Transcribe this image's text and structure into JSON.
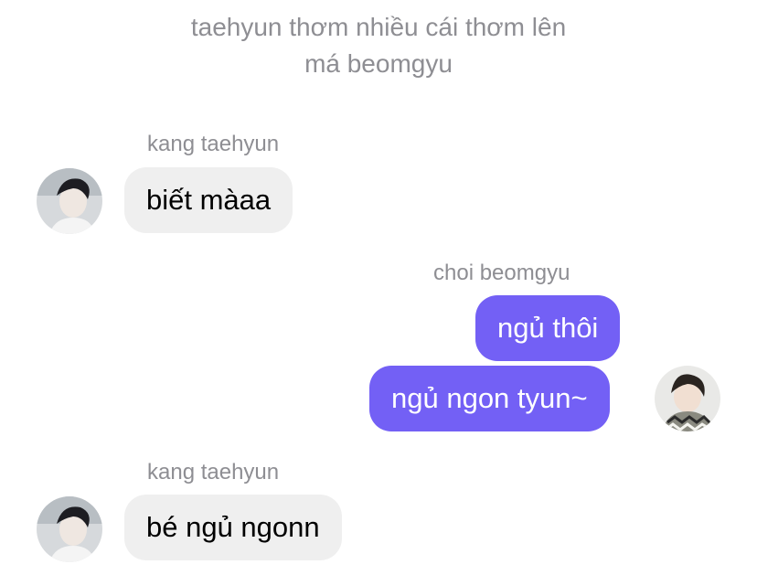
{
  "system_note": {
    "line1": "taehyun thơm nhiều cái thơm lên",
    "line2": "má beomgyu"
  },
  "messages": [
    {
      "sender": "kang taehyun",
      "text": "biết màaa",
      "direction": "incoming"
    },
    {
      "sender": "choi beomgyu",
      "texts": [
        "ngủ thôi",
        "ngủ ngon tyun~"
      ],
      "direction": "outgoing"
    },
    {
      "sender": "kang taehyun",
      "text": "bé ngủ ngonn",
      "direction": "incoming"
    }
  ],
  "colors": {
    "outgoing_bubble": "#7360f5",
    "incoming_bubble": "#efefef",
    "meta_text": "#8e8e93"
  },
  "icons": {
    "incoming_avatar": "avatar-photo",
    "outgoing_avatar": "avatar-photo"
  }
}
